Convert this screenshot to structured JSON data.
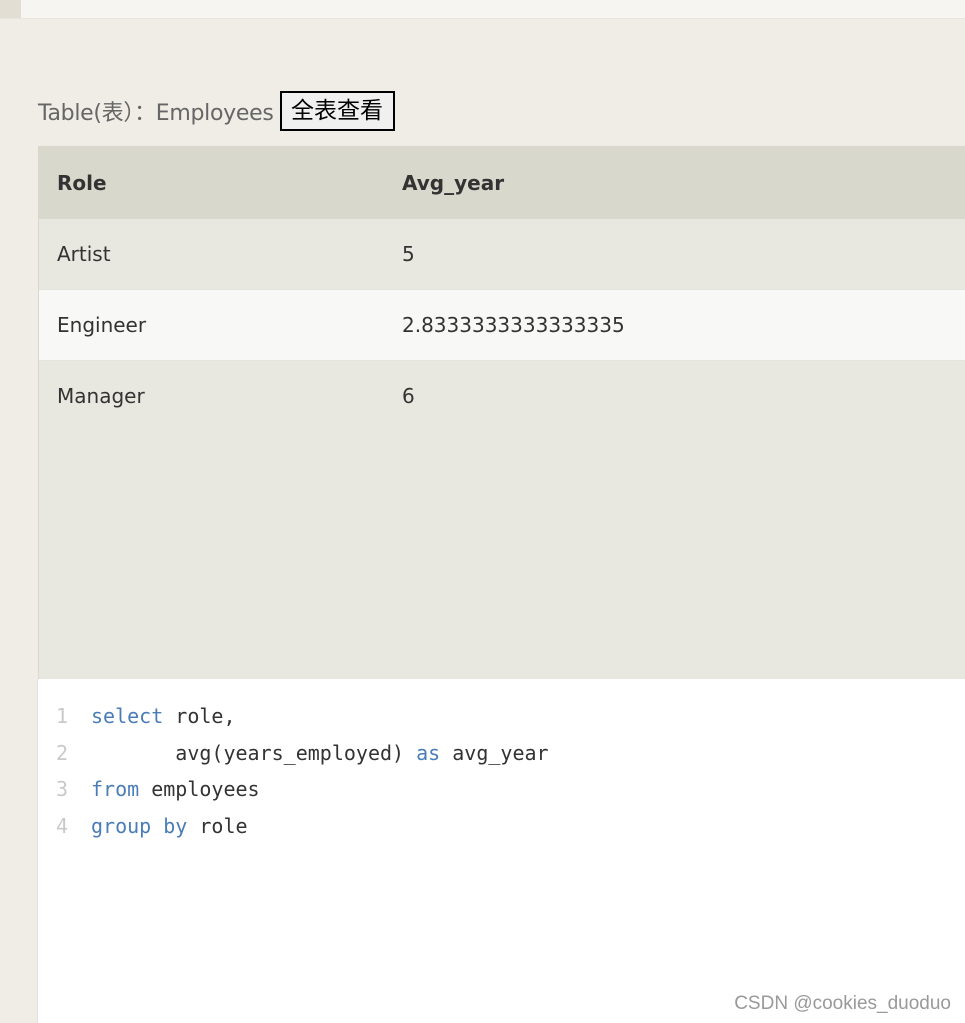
{
  "header": {
    "table_label": "Table(表）：Employees",
    "view_all_button": "全表查看"
  },
  "result_table": {
    "columns": [
      "Role",
      "Avg_year"
    ],
    "rows": [
      [
        "Artist",
        "5"
      ],
      [
        "Engineer",
        "2.8333333333333335"
      ],
      [
        "Manager",
        "6"
      ]
    ]
  },
  "code_editor": {
    "lines": [
      {
        "number": "1",
        "tokens": [
          {
            "text": "select",
            "kind": "keyword"
          },
          {
            "text": " role,",
            "kind": "plain"
          }
        ]
      },
      {
        "number": "2",
        "tokens": [
          {
            "text": "       avg(years_employed) ",
            "kind": "plain"
          },
          {
            "text": "as",
            "kind": "keyword"
          },
          {
            "text": " avg_year",
            "kind": "plain"
          }
        ]
      },
      {
        "number": "3",
        "tokens": [
          {
            "text": "from",
            "kind": "keyword"
          },
          {
            "text": " employees",
            "kind": "plain"
          }
        ]
      },
      {
        "number": "4",
        "tokens": [
          {
            "text": "group by",
            "kind": "keyword"
          },
          {
            "text": " role",
            "kind": "plain"
          }
        ]
      }
    ]
  },
  "watermark": "CSDN @cookies_duoduo",
  "colors": {
    "page_background": "#efede6",
    "table_header_background": "#d9d8cc",
    "table_body_background": "#e9e8e0",
    "alternate_row_background": "#f8f8f7",
    "sql_keyword": "#4a7db7",
    "line_number": "#c9c9c9"
  }
}
